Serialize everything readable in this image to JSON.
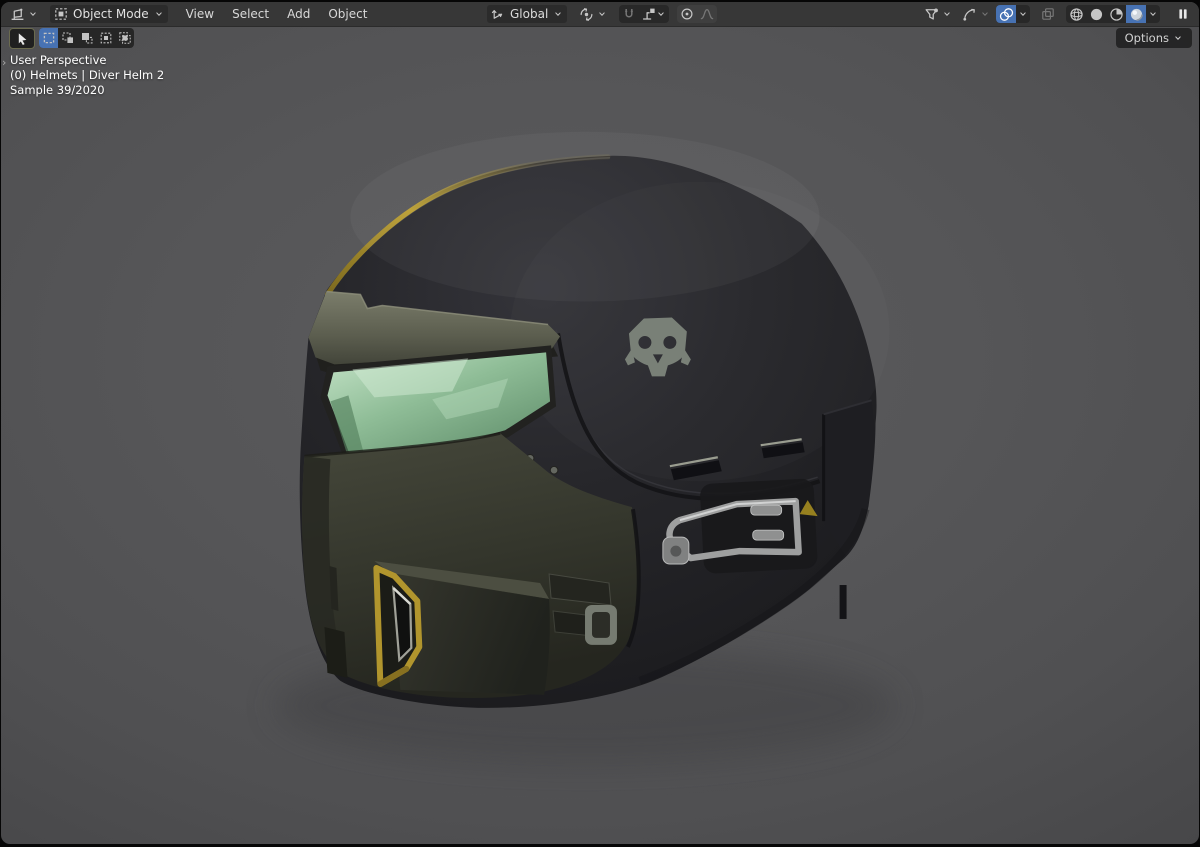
{
  "header": {
    "editor_selector": {
      "icon": "editor-3d-viewport-icon"
    },
    "mode_selector": {
      "icon": "object-mode-icon",
      "label": "Object Mode"
    },
    "menus": [
      {
        "label": "View"
      },
      {
        "label": "Select"
      },
      {
        "label": "Add"
      },
      {
        "label": "Object"
      }
    ],
    "transform_orientation": {
      "icon": "orientation-axes-icon",
      "label": "Global"
    },
    "pivot_point": {
      "icon": "pivot-point-icon"
    },
    "snapping": {
      "magnet_icon": "magnet-icon",
      "enabled": false,
      "target_icon": "snap-target-icon"
    },
    "proportional_editing": {
      "icon": "proportional-editing-icon",
      "falloff_icon": "falloff-curve-icon"
    },
    "visibility_filter": {
      "icon": "filter-funnel-icon"
    },
    "gizmos": {
      "icon": "gizmo-arc-icon"
    },
    "overlays": {
      "icon": "overlays-icon",
      "enabled": true
    },
    "xray": {
      "icon": "xray-toggle-icon",
      "enabled": false
    },
    "shading_modes": [
      {
        "name": "wireframe",
        "icon": "shading-wireframe-icon",
        "active": false
      },
      {
        "name": "solid",
        "icon": "shading-solid-icon",
        "active": false
      },
      {
        "name": "material-preview",
        "icon": "shading-material-icon",
        "active": false
      },
      {
        "name": "rendered",
        "icon": "shading-rendered-icon",
        "active": true
      }
    ],
    "pause_button": {
      "icon": "pause-icon"
    }
  },
  "tool_bar": {
    "active_tool": {
      "name": "tweak",
      "icon": "tweak-cursor-icon"
    },
    "select_modes": [
      {
        "name": "set",
        "icon": "select-set-icon",
        "active": true
      },
      {
        "name": "extend",
        "icon": "select-extend-icon",
        "active": false
      },
      {
        "name": "subtract",
        "icon": "select-subtract-icon",
        "active": false
      },
      {
        "name": "invert",
        "icon": "select-invert-icon",
        "active": false
      },
      {
        "name": "intersect",
        "icon": "select-intersect-icon",
        "active": false
      }
    ],
    "options_button": {
      "label": "Options"
    }
  },
  "viewport": {
    "overlay_text": {
      "view_name": "User Perspective",
      "active_object": "(0) Helmets | Diver Helm 2",
      "render_sample": "Sample 39/2020"
    },
    "scene_description": "dark combat diver helmet, green visor, yellow trim, gray skull emblem, metal side clamp"
  },
  "colors": {
    "accent_blue": "#4772b3",
    "header_bg": "#373737",
    "header_text": "#d9d9d9",
    "overlay_text": "#ffffff",
    "viewport_bg": "#565658",
    "helmet_dark": "#26262a",
    "jaw_olive": "#3a3c31",
    "visor_green": "#8fbd97",
    "trim_yellow": "#b1952d",
    "metal_gray": "#9e9f9f",
    "skull_gray": "#798077"
  }
}
